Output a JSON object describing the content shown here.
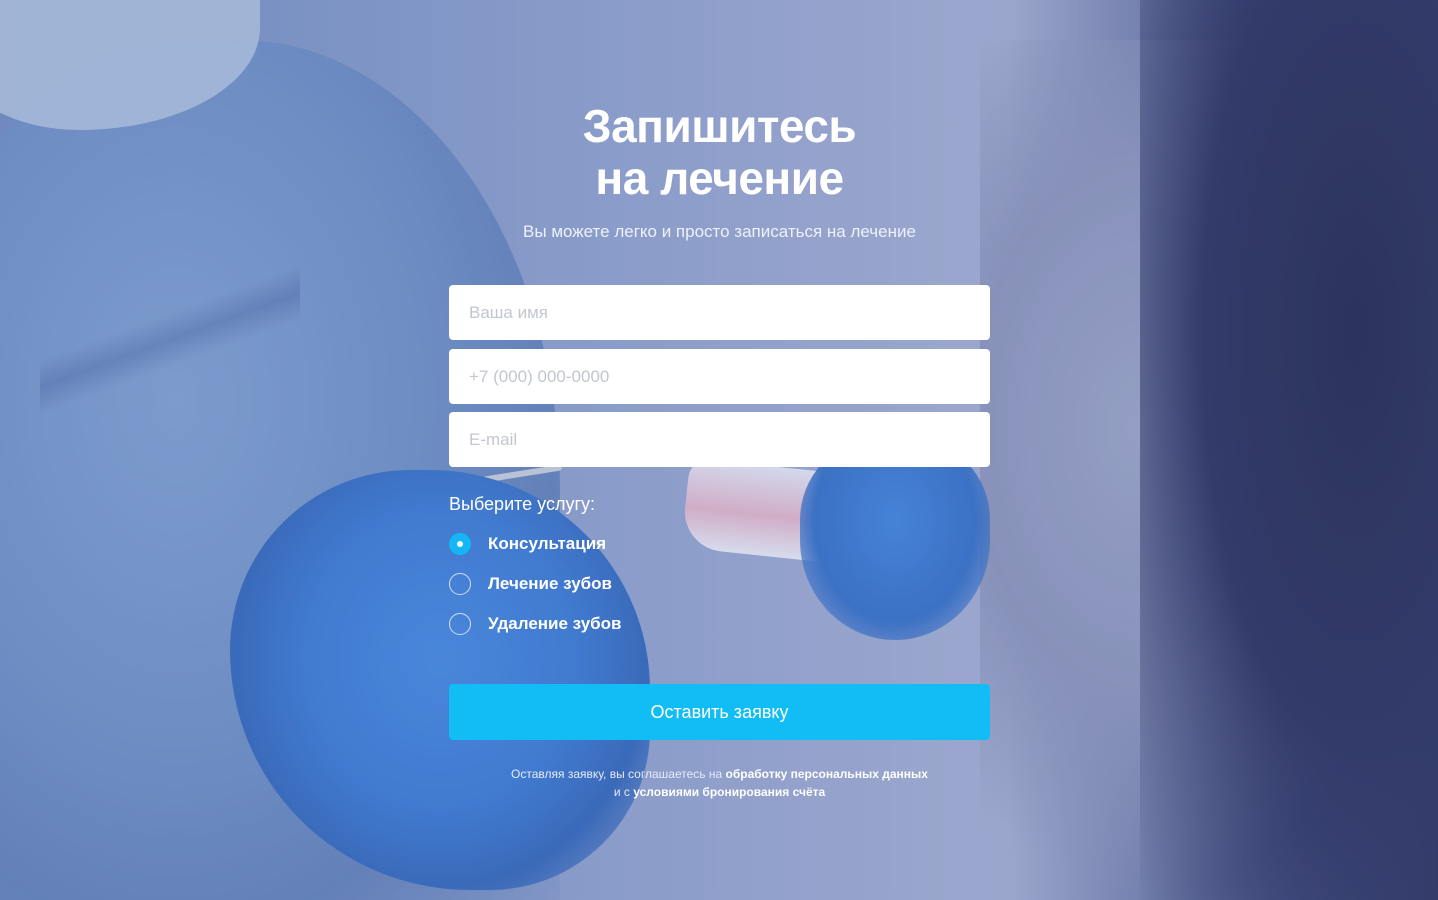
{
  "form": {
    "title_line1": "Запишитесь",
    "title_line2": "на лечение",
    "subtitle": "Вы можете легко и просто записаться на лечение",
    "name_placeholder": "Ваша имя",
    "phone_placeholder": "+7 (000) 000-0000",
    "email_placeholder": "E-mail",
    "service_label": "Выберите услугу:",
    "services": [
      {
        "label": "Консультация",
        "selected": true
      },
      {
        "label": "Лечение зубов",
        "selected": false
      },
      {
        "label": "Удаление зубов",
        "selected": false
      }
    ],
    "submit_label": "Оставить заявку",
    "consent": {
      "text_before": "Оставляя заявку, вы соглашаетесь на",
      "link1": "обработку персональных данных",
      "text_middle": "и с",
      "link2": "условиями бронирования счёта"
    }
  },
  "colors": {
    "accent": "#12bdf6",
    "text": "#ffffff",
    "field_bg": "#ffffff"
  }
}
